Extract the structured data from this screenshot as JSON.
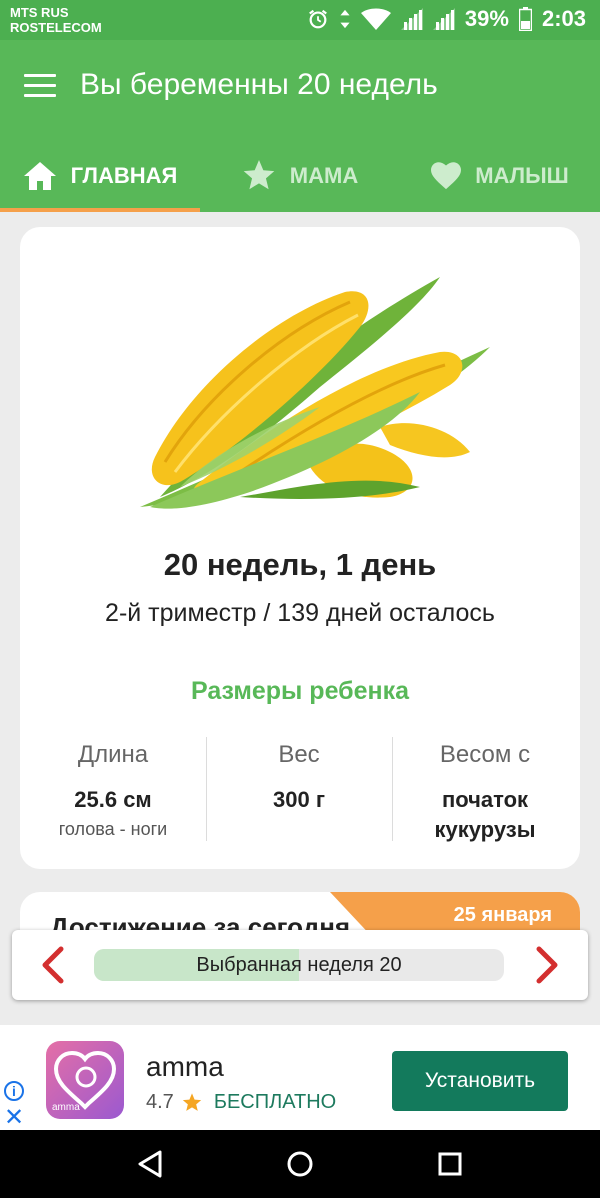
{
  "status_bar": {
    "carrier_1": "MTS RUS",
    "carrier_2": "ROSTELECOM",
    "battery": "39%",
    "time": "2:03",
    "icons": [
      "alarm-icon",
      "data-arrows-icon",
      "wifi-icon",
      "signal-icon",
      "signal-icon",
      "battery-icon"
    ]
  },
  "app_bar": {
    "title": "Вы беременны 20 недель",
    "menu_icon": "hamburger-menu-icon"
  },
  "tabs": [
    {
      "label": "ГЛАВНАЯ",
      "icon": "home-icon",
      "active": true
    },
    {
      "label": "МАМА",
      "icon": "star-icon",
      "active": false
    },
    {
      "label": "МАЛЫШ",
      "icon": "heart-icon",
      "active": false
    }
  ],
  "main_card": {
    "image": "corn-icon",
    "week_title": "20 недель, 1 день",
    "trimester_text": "2-й триместр / 139 дней осталось",
    "sizes_title": "Размеры ребенка",
    "stats": [
      {
        "label": "Длина",
        "value": "25.6 см",
        "sub": "голова - ноги"
      },
      {
        "label": "Вес",
        "value": "300 г",
        "sub": ""
      },
      {
        "label": "Весом с",
        "value": "початок кукурузы",
        "sub": ""
      }
    ]
  },
  "achievement_card": {
    "title": "Достижение за сегодня",
    "date": "25 января"
  },
  "week_selector": {
    "label": "Выбранная неделя 20",
    "progress_fraction": 0.5
  },
  "ad": {
    "app_name": "amma",
    "rating": "4.7",
    "price": "БЕСПЛАТНО",
    "install_label": "Установить",
    "icon_text": "amma"
  },
  "colors": {
    "primary_green": "#58b858",
    "accent_orange": "#f5a04a",
    "install_green": "#137a5c",
    "arrow_red": "#d32f2f"
  }
}
